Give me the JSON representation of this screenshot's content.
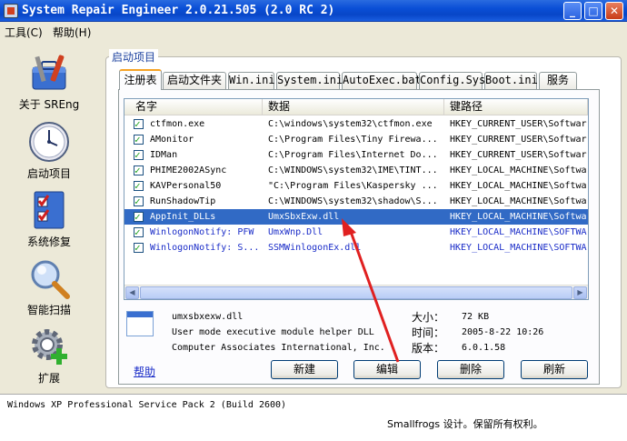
{
  "window": {
    "title": "System Repair Engineer 2.0.21.505 (2.0 RC 2)",
    "minimize": "_",
    "maximize": "□",
    "close": "✕"
  },
  "menu": {
    "tools": "工具(C)",
    "help": "帮助(H)"
  },
  "sidebar": {
    "items": [
      {
        "label": "关于 SREng",
        "icon": "toolbox-icon"
      },
      {
        "label": "启动项目",
        "icon": "clock-icon"
      },
      {
        "label": "系统修复",
        "icon": "checklist-icon"
      },
      {
        "label": "智能扫描",
        "icon": "magnifier-icon"
      },
      {
        "label": "扩展",
        "icon": "gear-plus-icon"
      }
    ]
  },
  "group": {
    "title": "启动项目"
  },
  "tabs": [
    "注册表",
    "启动文件夹",
    "Win.ini",
    "System.ini",
    "AutoExec.bat",
    "Config.Sys",
    "Boot.ini",
    "服务"
  ],
  "list": {
    "headers": [
      "名字",
      "数据",
      "键路径"
    ],
    "rows": [
      {
        "name": "ctfmon.exe",
        "data": "C:\\windows\\system32\\ctfmon.exe",
        "path": "HKEY_CURRENT_USER\\Softwar"
      },
      {
        "name": "AMonitor",
        "data": "C:\\Program Files\\Tiny Firewa...",
        "path": "HKEY_CURRENT_USER\\Softwar"
      },
      {
        "name": "IDMan",
        "data": "C:\\Program Files\\Internet Do...",
        "path": "HKEY_CURRENT_USER\\Softwar"
      },
      {
        "name": "PHIME2002ASync",
        "data": "C:\\WINDOWS\\system32\\IME\\TINT...",
        "path": "HKEY_LOCAL_MACHINE\\Softwa"
      },
      {
        "name": "KAVPersonal50",
        "data": "\"C:\\Program Files\\Kaspersky ...",
        "path": "HKEY_LOCAL_MACHINE\\Softwa"
      },
      {
        "name": "RunShadowTip",
        "data": "C:\\WINDOWS\\system32\\shadow\\S...",
        "path": "HKEY_LOCAL_MACHINE\\Softwa"
      },
      {
        "name": "AppInit_DLLs",
        "data": "UmxSbxExw.dll",
        "path": "HKEY_LOCAL_MACHINE\\Softwa"
      },
      {
        "name": "WinlogonNotify: PFW",
        "data": "UmxWnp.Dll",
        "path": "HKEY_LOCAL_MACHINE\\SOFTWA"
      },
      {
        "name": "WinlogonNotify: S...",
        "data": "SSMWinlogonEx.dll",
        "path": "HKEY_LOCAL_MACHINE\\SOFTWA"
      }
    ]
  },
  "detail": {
    "filename": "umxsbxexw.dll",
    "description": "User mode executive module helper DLL",
    "company": "Computer Associates International, Inc.",
    "size_label": "大小：",
    "size_value": "72 KB",
    "time_label": "时间：",
    "time_value": "2005-8-22 10:26",
    "version_label": "版本：",
    "version_value": "6.0.1.58"
  },
  "buttons": {
    "help": "帮助",
    "new": "新建",
    "edit": "编辑",
    "delete": "删除",
    "refresh": "刷新"
  },
  "status": {
    "os": "Windows XP Professional Service Pack 2 (Build 2600)",
    "copyright": "Smallfrogs 设计。保留所有权利。"
  },
  "colors": {
    "titlebar": "#0a4fd6",
    "selection": "#316ac5",
    "link": "#1a2cc8",
    "arrow": "#e02020"
  }
}
